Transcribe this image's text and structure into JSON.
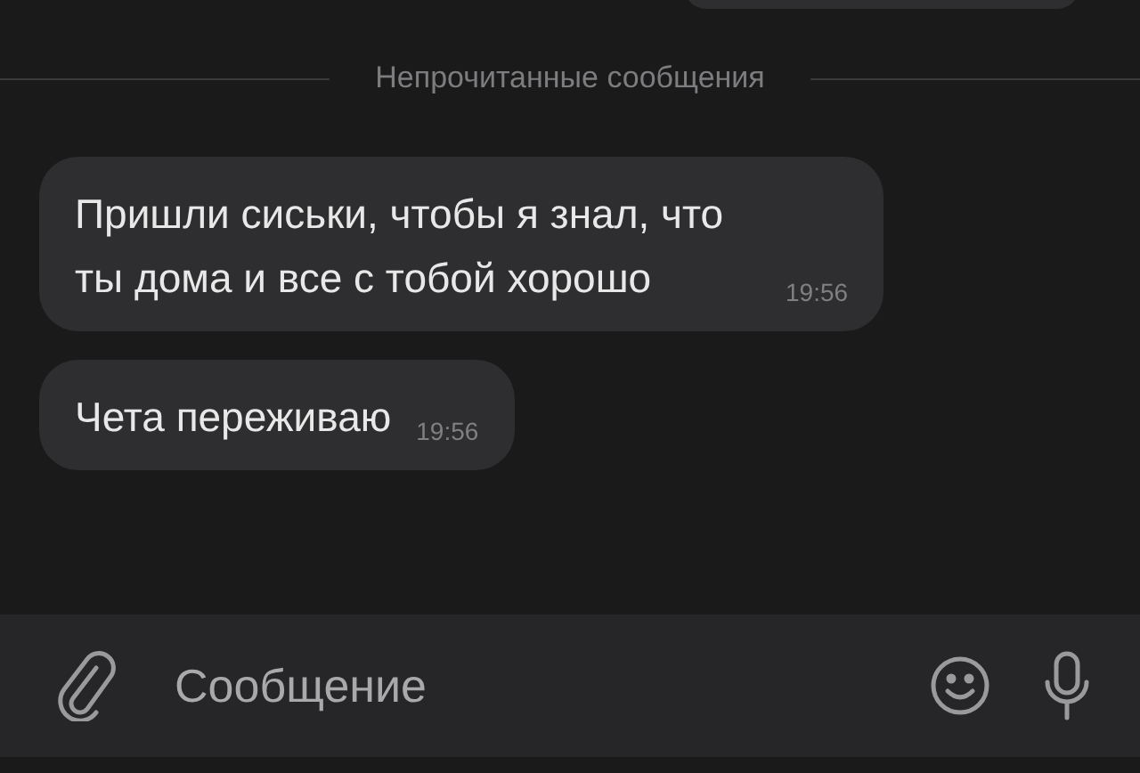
{
  "divider": {
    "label": "Непрочитанные сообщения"
  },
  "messages": [
    {
      "text": "Пришли сиськи, чтобы я знал, что ты дома и все с тобой хорошо",
      "time": "19:56"
    },
    {
      "text": "Чета переживаю",
      "time": "19:56"
    }
  ],
  "composer": {
    "placeholder": "Сообщение"
  }
}
